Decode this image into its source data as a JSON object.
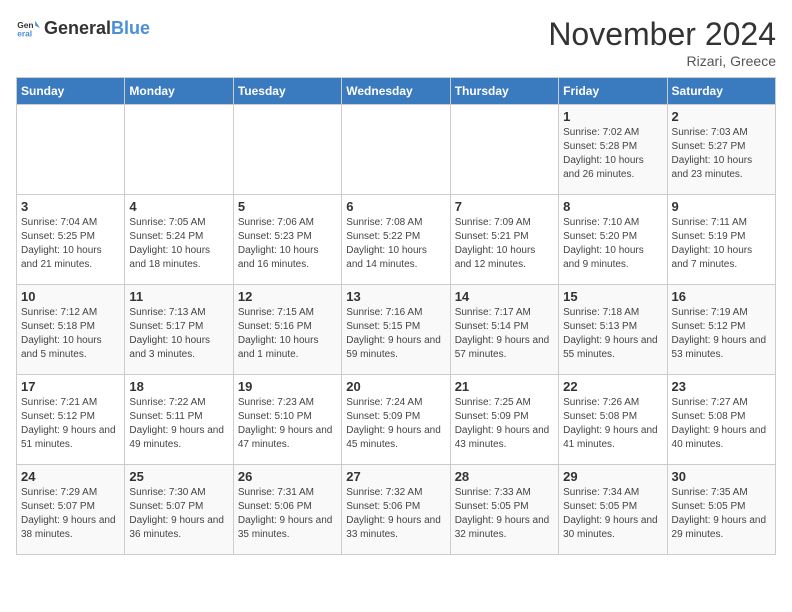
{
  "header": {
    "logo_general": "General",
    "logo_blue": "Blue",
    "title": "November 2024",
    "location": "Rizari, Greece"
  },
  "days_of_week": [
    "Sunday",
    "Monday",
    "Tuesday",
    "Wednesday",
    "Thursday",
    "Friday",
    "Saturday"
  ],
  "weeks": [
    [
      {
        "day": "",
        "info": ""
      },
      {
        "day": "",
        "info": ""
      },
      {
        "day": "",
        "info": ""
      },
      {
        "day": "",
        "info": ""
      },
      {
        "day": "",
        "info": ""
      },
      {
        "day": "1",
        "info": "Sunrise: 7:02 AM\nSunset: 5:28 PM\nDaylight: 10 hours and 26 minutes."
      },
      {
        "day": "2",
        "info": "Sunrise: 7:03 AM\nSunset: 5:27 PM\nDaylight: 10 hours and 23 minutes."
      }
    ],
    [
      {
        "day": "3",
        "info": "Sunrise: 7:04 AM\nSunset: 5:25 PM\nDaylight: 10 hours and 21 minutes."
      },
      {
        "day": "4",
        "info": "Sunrise: 7:05 AM\nSunset: 5:24 PM\nDaylight: 10 hours and 18 minutes."
      },
      {
        "day": "5",
        "info": "Sunrise: 7:06 AM\nSunset: 5:23 PM\nDaylight: 10 hours and 16 minutes."
      },
      {
        "day": "6",
        "info": "Sunrise: 7:08 AM\nSunset: 5:22 PM\nDaylight: 10 hours and 14 minutes."
      },
      {
        "day": "7",
        "info": "Sunrise: 7:09 AM\nSunset: 5:21 PM\nDaylight: 10 hours and 12 minutes."
      },
      {
        "day": "8",
        "info": "Sunrise: 7:10 AM\nSunset: 5:20 PM\nDaylight: 10 hours and 9 minutes."
      },
      {
        "day": "9",
        "info": "Sunrise: 7:11 AM\nSunset: 5:19 PM\nDaylight: 10 hours and 7 minutes."
      }
    ],
    [
      {
        "day": "10",
        "info": "Sunrise: 7:12 AM\nSunset: 5:18 PM\nDaylight: 10 hours and 5 minutes."
      },
      {
        "day": "11",
        "info": "Sunrise: 7:13 AM\nSunset: 5:17 PM\nDaylight: 10 hours and 3 minutes."
      },
      {
        "day": "12",
        "info": "Sunrise: 7:15 AM\nSunset: 5:16 PM\nDaylight: 10 hours and 1 minute."
      },
      {
        "day": "13",
        "info": "Sunrise: 7:16 AM\nSunset: 5:15 PM\nDaylight: 9 hours and 59 minutes."
      },
      {
        "day": "14",
        "info": "Sunrise: 7:17 AM\nSunset: 5:14 PM\nDaylight: 9 hours and 57 minutes."
      },
      {
        "day": "15",
        "info": "Sunrise: 7:18 AM\nSunset: 5:13 PM\nDaylight: 9 hours and 55 minutes."
      },
      {
        "day": "16",
        "info": "Sunrise: 7:19 AM\nSunset: 5:12 PM\nDaylight: 9 hours and 53 minutes."
      }
    ],
    [
      {
        "day": "17",
        "info": "Sunrise: 7:21 AM\nSunset: 5:12 PM\nDaylight: 9 hours and 51 minutes."
      },
      {
        "day": "18",
        "info": "Sunrise: 7:22 AM\nSunset: 5:11 PM\nDaylight: 9 hours and 49 minutes."
      },
      {
        "day": "19",
        "info": "Sunrise: 7:23 AM\nSunset: 5:10 PM\nDaylight: 9 hours and 47 minutes."
      },
      {
        "day": "20",
        "info": "Sunrise: 7:24 AM\nSunset: 5:09 PM\nDaylight: 9 hours and 45 minutes."
      },
      {
        "day": "21",
        "info": "Sunrise: 7:25 AM\nSunset: 5:09 PM\nDaylight: 9 hours and 43 minutes."
      },
      {
        "day": "22",
        "info": "Sunrise: 7:26 AM\nSunset: 5:08 PM\nDaylight: 9 hours and 41 minutes."
      },
      {
        "day": "23",
        "info": "Sunrise: 7:27 AM\nSunset: 5:08 PM\nDaylight: 9 hours and 40 minutes."
      }
    ],
    [
      {
        "day": "24",
        "info": "Sunrise: 7:29 AM\nSunset: 5:07 PM\nDaylight: 9 hours and 38 minutes."
      },
      {
        "day": "25",
        "info": "Sunrise: 7:30 AM\nSunset: 5:07 PM\nDaylight: 9 hours and 36 minutes."
      },
      {
        "day": "26",
        "info": "Sunrise: 7:31 AM\nSunset: 5:06 PM\nDaylight: 9 hours and 35 minutes."
      },
      {
        "day": "27",
        "info": "Sunrise: 7:32 AM\nSunset: 5:06 PM\nDaylight: 9 hours and 33 minutes."
      },
      {
        "day": "28",
        "info": "Sunrise: 7:33 AM\nSunset: 5:05 PM\nDaylight: 9 hours and 32 minutes."
      },
      {
        "day": "29",
        "info": "Sunrise: 7:34 AM\nSunset: 5:05 PM\nDaylight: 9 hours and 30 minutes."
      },
      {
        "day": "30",
        "info": "Sunrise: 7:35 AM\nSunset: 5:05 PM\nDaylight: 9 hours and 29 minutes."
      }
    ]
  ]
}
